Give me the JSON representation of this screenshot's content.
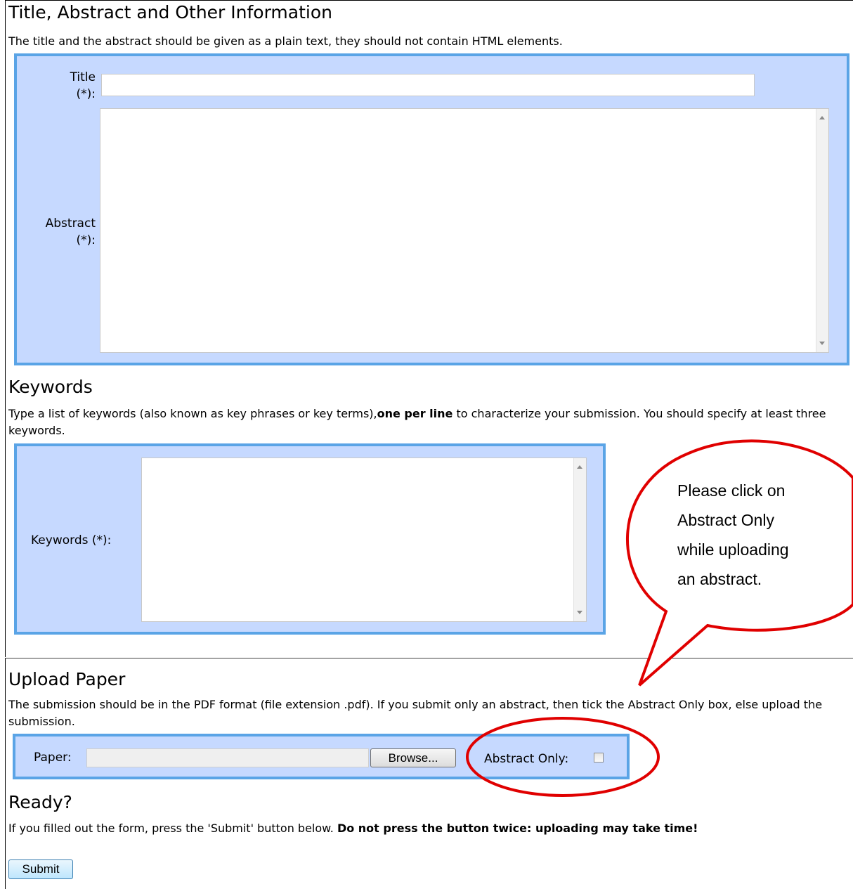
{
  "title_section": {
    "heading": "Title, Abstract and Other Information",
    "description": "The title and the abstract should be given as a plain text, they should not contain HTML elements.",
    "title_label_line1": "Title",
    "title_label_line2": "(*):",
    "abstract_label_line1": "Abstract",
    "abstract_label_line2": "(*):",
    "title_value": "",
    "abstract_value": ""
  },
  "keywords_section": {
    "heading": "Keywords",
    "description_pre": "Type a list of keywords (also known as key phrases or key terms),",
    "description_bold": "one per line",
    "description_post": " to characterize your submission. You should specify at least three keywords.",
    "keywords_label": "Keywords (*):",
    "keywords_value": ""
  },
  "upload_section": {
    "heading": "Upload Paper",
    "description": "The submission should be in the PDF format (file extension .pdf). If you submit only an abstract, then tick the Abstract Only box, else upload the submission.",
    "paper_label": "Paper:",
    "browse_label": "Browse...",
    "abstract_only_label": "Abstract Only:",
    "abstract_only_checked": false
  },
  "ready_section": {
    "heading": "Ready?",
    "description_pre": "If you filled out the form, press the 'Submit' button below. ",
    "description_bold": "Do not press the button twice: uploading may take time!",
    "submit_label": "Submit"
  },
  "callout": {
    "lines": [
      "Please click on",
      "Abstract Only",
      "while uploading",
      "an abstract."
    ],
    "color": "#e00000"
  },
  "colors": {
    "panel_bg": "#c6d9ff",
    "panel_border": "#5aa4e6",
    "annotation_red": "#e00000"
  }
}
